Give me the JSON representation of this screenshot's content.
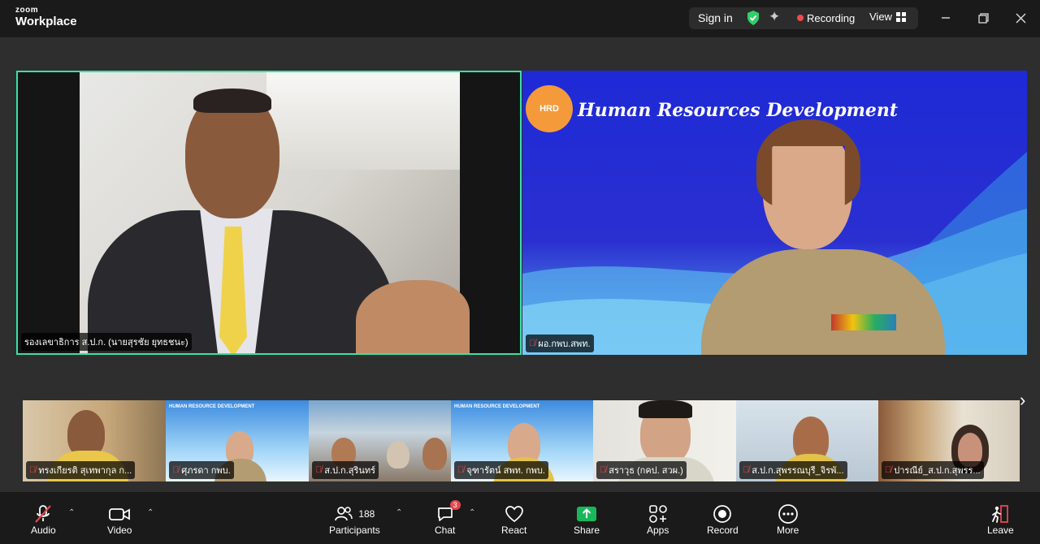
{
  "app": {
    "brand_top": "zoom",
    "brand_name": "Workplace"
  },
  "topbar": {
    "sign_in": "Sign in",
    "recording": "Recording",
    "view": "View",
    "accent": "#3ae1a4",
    "recording_color": "#f04b4b"
  },
  "main_tiles": [
    {
      "name": "รองเลขาธิการ ส.ป.ก. (นายสุรชัย ยุทธชนะ)",
      "active_speaker": true,
      "mic_muted": false
    },
    {
      "name": "ผอ.กพบ.สพท.",
      "mic_muted": true,
      "banner_title": "Human Resources Development",
      "banner_logo": "HRD"
    }
  ],
  "thumbnails": [
    {
      "name": "ทรงเกียรติ สุเทพากุล ก..."
    },
    {
      "name": "ศุภรดา กพบ.",
      "banner": "HUMAN RESOURCE DEVELOPMENT"
    },
    {
      "name": "ส.ป.ก.สุรินทร์"
    },
    {
      "name": "จุฑารัตน์ สพท. กพบ.",
      "banner": "HUMAN RESOURCE DEVELOPMENT"
    },
    {
      "name": "สราวุธ (กคป. สวผ.)"
    },
    {
      "name": "ส.ป.ก.สุพรรณบุรี_จิรพั..."
    },
    {
      "name": "ปารณีย์_ส.ป.ก.สุพรร..."
    }
  ],
  "toolbar": {
    "audio": "Audio",
    "video": "Video",
    "participants": "Participants",
    "participant_count": "188",
    "chat": "Chat",
    "chat_badge": "3",
    "react": "React",
    "share": "Share",
    "apps": "Apps",
    "record": "Record",
    "more": "More",
    "leave": "Leave"
  }
}
